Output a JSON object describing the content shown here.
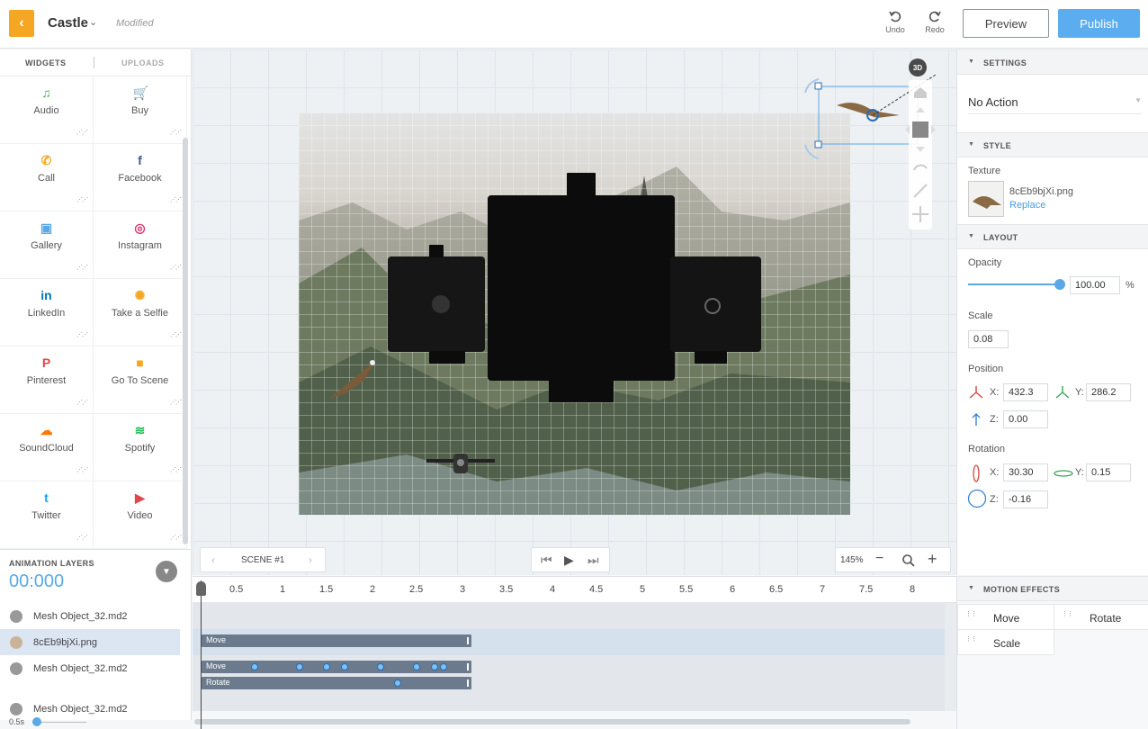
{
  "header": {
    "back_glyph": "‹",
    "title": "Castle",
    "caret": "⌄",
    "status": "Modified",
    "undo_label": "Undo",
    "redo_label": "Redo",
    "preview_label": "Preview",
    "publish_label": "Publish"
  },
  "widgets_panel": {
    "tabs": [
      "WIDGETS",
      "UPLOADS"
    ],
    "items": [
      {
        "label": "Audio",
        "icon": "music-note-icon",
        "color": "#4caf50",
        "glyph": "♫"
      },
      {
        "label": "Buy",
        "icon": "cart-icon",
        "color": "#f5a623",
        "glyph": "🛒"
      },
      {
        "label": "Call",
        "icon": "phone-icon",
        "color": "#f5a623",
        "glyph": "✆"
      },
      {
        "label": "Facebook",
        "icon": "facebook-icon",
        "color": "#3b5998",
        "glyph": "f"
      },
      {
        "label": "Gallery",
        "icon": "gallery-icon",
        "color": "#5aa9e6",
        "glyph": "▣"
      },
      {
        "label": "Instagram",
        "icon": "instagram-icon",
        "color": "#e1306c",
        "glyph": "◎"
      },
      {
        "label": "LinkedIn",
        "icon": "linkedin-icon",
        "color": "#0077b5",
        "glyph": "in"
      },
      {
        "label": "Take a Selfie",
        "icon": "aperture-icon",
        "color": "#f5a623",
        "glyph": "✺"
      },
      {
        "label": "Pinterest",
        "icon": "pinterest-icon",
        "color": "#e0464a",
        "glyph": "P"
      },
      {
        "label": "Go To Scene",
        "icon": "video-camera-icon",
        "color": "#f5a623",
        "glyph": "■"
      },
      {
        "label": "SoundCloud",
        "icon": "soundcloud-icon",
        "color": "#ff7700",
        "glyph": "☁"
      },
      {
        "label": "Spotify",
        "icon": "spotify-icon",
        "color": "#1db954",
        "glyph": "≋"
      },
      {
        "label": "Twitter",
        "icon": "twitter-icon",
        "color": "#1da1f2",
        "glyph": "t"
      },
      {
        "label": "Video",
        "icon": "play-icon",
        "color": "#e0464a",
        "glyph": "▶"
      }
    ]
  },
  "canvas": {
    "badge_3d": "3D",
    "scene_label": "SCENE #1",
    "zoom": "145%"
  },
  "settings": {
    "settings_title": "SETTINGS",
    "action_value": "No Action",
    "style_title": "STYLE",
    "texture_label": "Texture",
    "texture_file": "8cEb9bjXi.png",
    "replace_label": "Replace",
    "layout_title": "LAYOUT",
    "opacity_label": "Opacity",
    "opacity_value": "100.00",
    "opacity_unit": "%",
    "opacity_fraction": 1.0,
    "scale_label": "Scale",
    "scale_value": "0.08",
    "position_label": "Position",
    "pos_x": "432.3",
    "pos_y": "286.2",
    "pos_z": "0.00",
    "rotation_label": "Rotation",
    "rot_x": "30.30",
    "rot_y": "0.15",
    "rot_z": "-0.16",
    "x_lbl": "X:",
    "y_lbl": "Y:",
    "z_lbl": "Z:"
  },
  "timeline": {
    "title": "ANIMATION LAYERS",
    "time": "00:000",
    "ticks": [
      "0.5",
      "1",
      "1.5",
      "2",
      "2.5",
      "3",
      "3.5",
      "4",
      "4.5",
      "5",
      "5.5",
      "6",
      "6.5",
      "7",
      "7.5",
      "8"
    ],
    "layers": [
      "Mesh Object_32.md2",
      "8cEb9bjXi.png",
      "Mesh Object_32.md2",
      "Mesh Object_32.md2"
    ],
    "track_move_label": "Move",
    "track_rotate_label": "Rotate",
    "speed": "0.5s"
  },
  "motion_effects": {
    "title": "MOTION EFFECTS",
    "items": [
      "Move",
      "Rotate",
      "Scale"
    ]
  }
}
